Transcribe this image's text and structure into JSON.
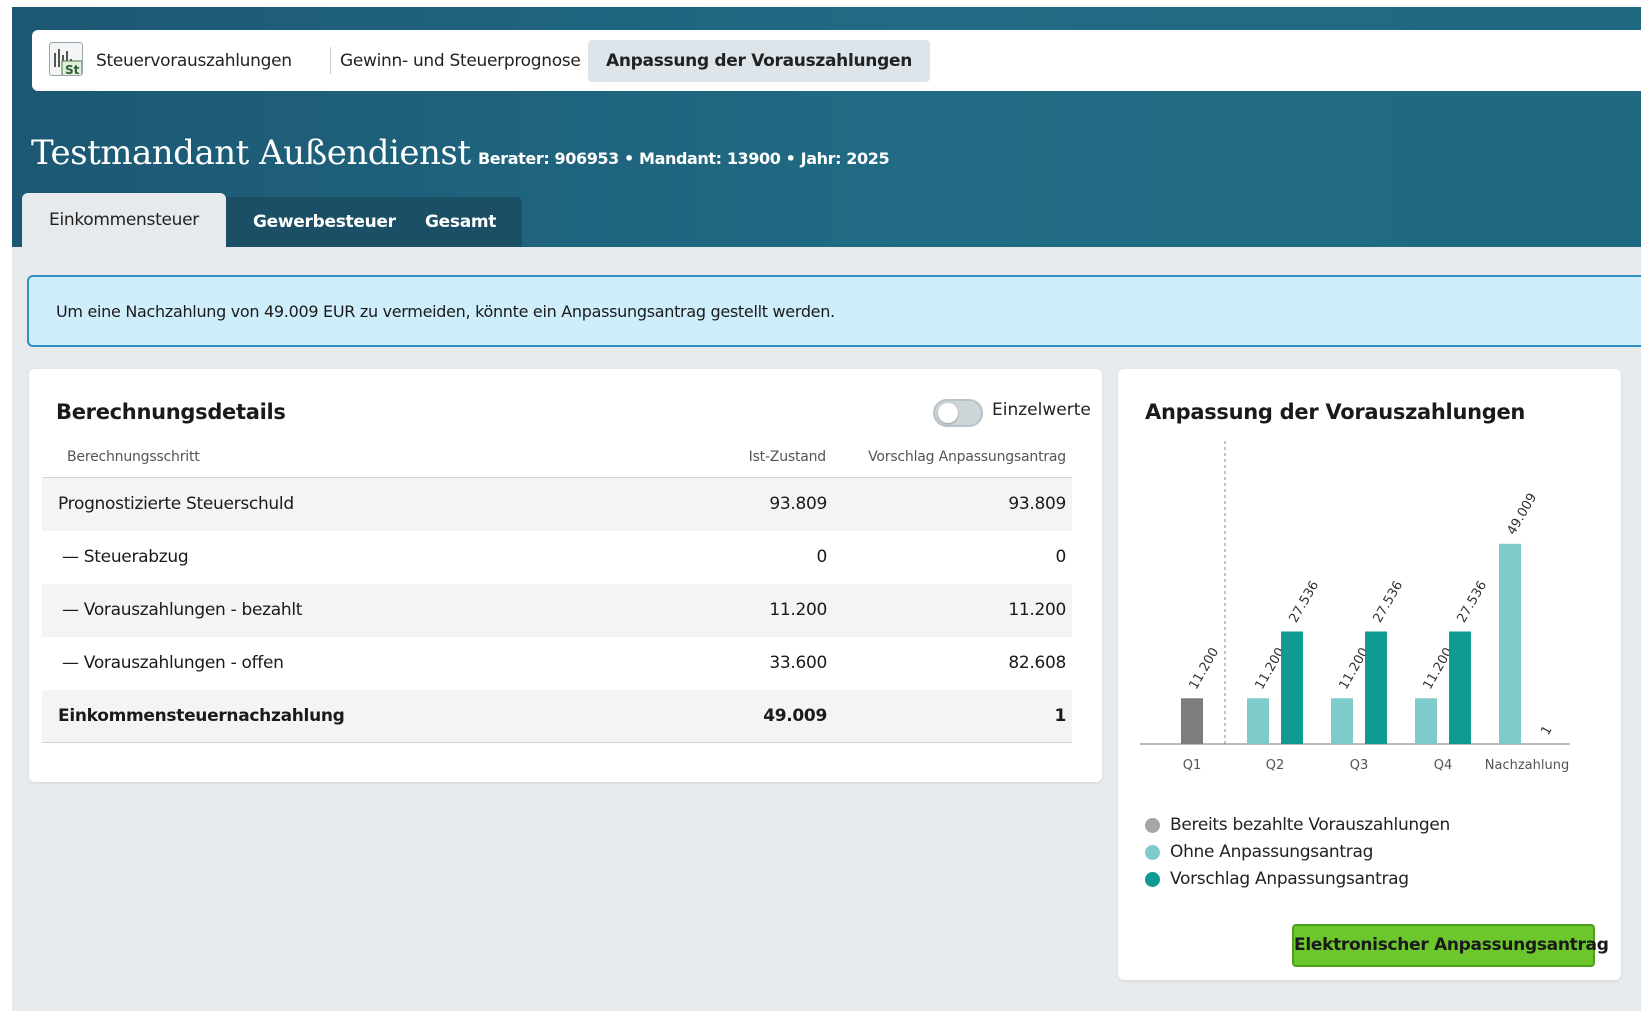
{
  "topnav": {
    "items": [
      {
        "label": "Steuervorauszahlungen"
      },
      {
        "label": "Gewinn- und Steuerprognose"
      },
      {
        "label": "Anpassung der Vorauszahlungen"
      }
    ]
  },
  "header": {
    "client_name": "Testmandant Außendienst",
    "meta": "Berater: 906953 • Mandant: 13900 • Jahr: 2025"
  },
  "tabs": [
    {
      "label": "Einkommensteuer",
      "active": true
    },
    {
      "label": "Gewerbesteuer",
      "active": false
    },
    {
      "label": "Gesamt",
      "active": false
    }
  ],
  "alert": {
    "text": "Um eine Nachzahlung von 49.009 EUR zu vermeiden, könnte ein Anpassungsantrag gestellt werden."
  },
  "details": {
    "title": "Berechnungsdetails",
    "toggle_label": "Einzelwerte",
    "toggle_on": false,
    "columns": [
      "Berechnungsschritt",
      "Ist-Zustand",
      "Vorschlag Anpassungsantrag"
    ],
    "rows": [
      {
        "label": "Prognostizierte Steuerschuld",
        "ist": "93.809",
        "vorschlag": "93.809"
      },
      {
        "label": "— Steuerabzug",
        "ist": "0",
        "vorschlag": "0"
      },
      {
        "label": "— Vorauszahlungen - bezahlt",
        "ist": "11.200",
        "vorschlag": "11.200"
      },
      {
        "label": "— Vorauszahlungen - offen",
        "ist": "33.600",
        "vorschlag": "82.608"
      },
      {
        "label": "Einkommensteuernachzahlung",
        "ist": "49.009",
        "vorschlag": "1"
      }
    ]
  },
  "chart_panel": {
    "title": "Anpassung der Vorauszahlungen",
    "button_label": "Elektronischer Anpassungsantrag"
  },
  "colors": {
    "paid": "#7d7d7d",
    "without": "#7ecbcc",
    "proposal": "#0f9a94",
    "button": "#6cc72c"
  },
  "chart_data": {
    "type": "bar",
    "categories": [
      "Q1",
      "Q2",
      "Q3",
      "Q4",
      "Nachzahlung"
    ],
    "series": [
      {
        "name": "Bereits bezahlte Vorauszahlungen",
        "values": [
          11200,
          null,
          null,
          null,
          null
        ]
      },
      {
        "name": "Ohne Anpassungsantrag",
        "values": [
          null,
          11200,
          11200,
          11200,
          49009
        ]
      },
      {
        "name": "Vorschlag Anpassungsantrag",
        "values": [
          null,
          27536,
          27536,
          27536,
          1
        ]
      }
    ],
    "data_labels": {
      "Q1": [
        "11.200"
      ],
      "Q2": [
        "11.200",
        "27.536"
      ],
      "Q3": [
        "11.200",
        "27.536"
      ],
      "Q4": [
        "11.200",
        "27.536"
      ],
      "Nachzahlung": [
        "49.009",
        "1"
      ]
    },
    "ylim": [
      0,
      55000
    ],
    "legend": "bottom",
    "grid": false,
    "divider_after": "Q1"
  }
}
